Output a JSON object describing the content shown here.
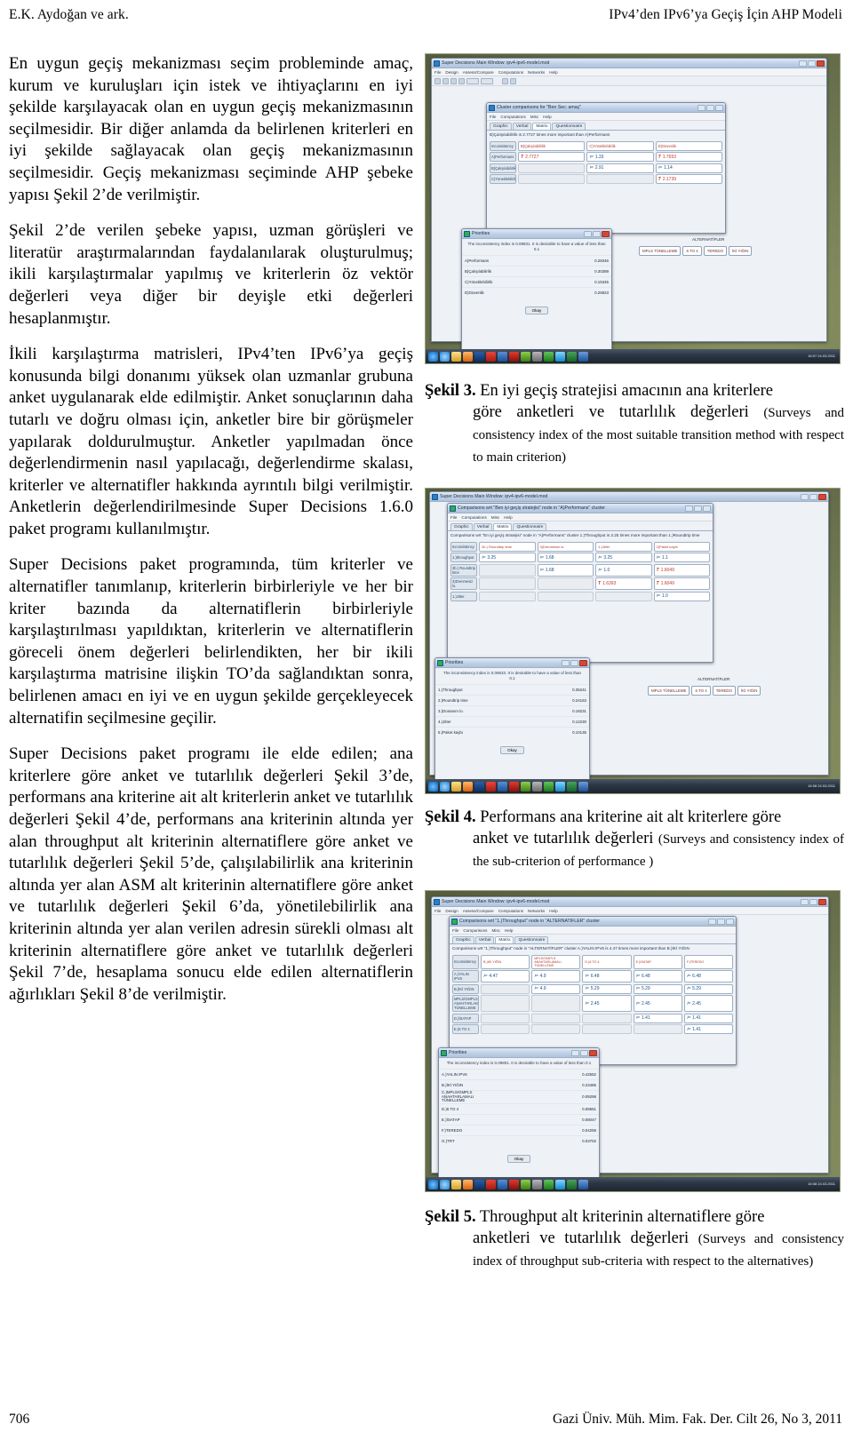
{
  "running_head": {
    "left": "E.K. Aydoğan ve ark.",
    "right": "IPv4’den IPv6’ya Geçiş İçin AHP Modeli"
  },
  "footer": {
    "page_number": "706",
    "journal": "Gazi Üniv. Müh. Mim. Fak. Der. Cilt 26, No 3, 2011"
  },
  "left_column": {
    "paragraphs": [
      "En uygun geçiş mekanizması seçim probleminde amaç, kurum ve kuruluşları için istek ve ihtiyaçlarını en iyi şekilde karşılayacak olan en uygun geçiş mekanizmasının seçilmesidir. Bir diğer anlamda da belirlenen kriterleri en iyi şekilde sağlayacak olan geçiş mekanizmasının seçilmesidir. Geçiş mekanizması seçiminde AHP şebeke yapısı Şekil 2’de verilmiştir.",
      "Şekil 2’de verilen şebeke yapısı,  uzman görüşleri ve literatür araştırmalarından faydalanılarak oluşturulmuş; ikili karşılaştırmalar yapılmış ve kriterlerin öz vektör değerleri veya diğer bir deyişle etki değerleri hesaplanmıştır.",
      "İkili karşılaştırma matrisleri, IPv4’ten IPv6’ya geçiş konusunda bilgi donanımı yüksek olan uzmanlar grubuna anket uygulanarak elde edilmiştir. Anket sonuçlarının daha tutarlı ve doğru olması için, anketler bire bir görüşmeler yapılarak doldurulmuştur. Anketler yapılmadan önce değerlendirmenin nasıl yapılacağı, değerlendirme skalası, kriterler ve alternatifler hakkında ayrıntılı bilgi verilmiştir. Anketlerin değerlendirilmesinde Super Decisions 1.6.0 paket programı kullanılmıştır.",
      "Super Decisions paket programında, tüm kriterler ve alternatifler tanımlanıp, kriterlerin birbirleriyle ve her bir kriter bazında da alternatiflerin birbirleriyle karşılaştırılması yapıldıktan, kriterlerin ve alternatiflerin göreceli önem değerleri belirlendikten, her bir ikili karşılaştırma matrisine ilişkin TO’da sağlandıktan sonra, belirlenen amacı en iyi ve en uygun şekilde gerçekleyecek alternatifin seçilmesine geçilir.",
      "Super Decisions paket programı ile elde edilen; ana kriterlere göre anket ve tutarlılık değerleri Şekil 3’de, performans ana kriterine ait alt kriterlerin anket ve tutarlılık değerleri Şekil 4’de, performans ana kriterinin altında yer alan throughput alt kriterinin alternatiflere göre anket ve tutarlılık değerleri Şekil 5’de, çalışılabilirlik ana kriterinin altında yer alan ASM alt kriterinin alternatiflere göre anket ve tutarlılık değerleri Şekil 6’da, yönetilebilirlik ana kriterinin altında yer alan verilen adresin sürekli olması alt kriterinin alternatiflere göre anket ve tutarlılık değerleri Şekil 7’de, hesaplama sonucu elde edilen alternatiflerin ağırlıkları Şekil 8’de verilmiştir."
    ]
  },
  "figures": [
    {
      "id": "fig3",
      "label": "Şekil 3.",
      "caption_tr_line1": "En iyi geçiş stratejisi amacının ana kriterlere",
      "caption_tr_line2": "göre anketleri ve tutarlılık değerleri",
      "caption_en": "(Surveys and consistency index of the most suitable transition method with respect to main criterion)",
      "screenshot": {
        "main_window_title": "Super Decisions Main Window: ipv4-ipv6-model.mod",
        "main_menu": [
          "File",
          "Design",
          "Assess/Compare",
          "Computations",
          "Networks",
          "Help"
        ],
        "dialog_title": "Cluster comparisons for \"Ben Sec: amaç\"",
        "dialog_menu": [
          "File",
          "Computations",
          "Misc",
          "Help"
        ],
        "tabs": [
          "Graphic",
          "Verbal",
          "Matrix",
          "Questionnaire"
        ],
        "tabs_active": "Matrix",
        "note": "B)Çalışılabilirlik is 2.7727 times more important than A)Performans",
        "matrix": {
          "corner_label": "Inconsistency",
          "col_headers": [
            "B)Çalışılabilirlik",
            "C)Yönetilebilirlik",
            "D)Güvenlik"
          ],
          "row_headers": [
            "A)Performans",
            "B)Çalışılabilirlik",
            "C)Yönetilebilirlik"
          ],
          "cells": [
            [
              "2.7727",
              "1.33",
              "1.7653"
            ],
            [
              "",
              "2.91",
              "1.14"
            ],
            [
              "",
              "",
              "2.1739"
            ]
          ],
          "red_flags": [
            [
              true,
              false,
              true
            ],
            [
              false,
              false,
              false
            ],
            [
              false,
              false,
              true
            ]
          ]
        },
        "priorities": {
          "title": "Priorities",
          "note": "The inconsistency index is 0.08831. It is desirable to have a value of less than 0.1",
          "rows": [
            {
              "name": "A)Performans",
              "value": "0.28346"
            },
            {
              "name": "B)Çalışılabilirlik",
              "value": "0.30389"
            },
            {
              "name": "C)Yönetilebilirlik",
              "value": "0.15345"
            },
            {
              "name": "D)Güvenlik",
              "value": "0.25823"
            }
          ],
          "ok_button": "Okay"
        },
        "alternatives_label": "ALTERNATİFLER",
        "alternative_buttons": [
          "MPLS TÜNELLEME",
          "6 TO 4",
          "TEREDO",
          "İKİ YIĞIN"
        ],
        "taskbar_clock": "16:07 24.03.2011"
      }
    },
    {
      "id": "fig4",
      "label": "Şekil 4.",
      "caption_tr_line1": "Performans ana kriterine ait alt kriterlere göre",
      "caption_tr_line2": "anket ve tutarlılık değerleri",
      "caption_en": "(Surveys and consistency index of the sub-criterion of performance )",
      "screenshot": {
        "main_window_title": "Super Decisions Main Window: ipv4-ipv6-model.mod",
        "dialog_title": "Comparisons wrt \"Ben iyi geçiş stratejisi\" node in \"A)Performans\" cluster",
        "dialog_menu": [
          "File",
          "Computations",
          "Misc",
          "Help"
        ],
        "tabs": [
          "Graphic",
          "Verbal",
          "Matrix",
          "Questionnaire"
        ],
        "tabs_active": "Matrix",
        "note": "Comparisons wrt \"En iyi geçiş stratejisi\" node in \"A)Performans\" cluster 1.)Throughput is 3.25 times more important than 1.)Roundtrip time",
        "matrix": {
          "corner_label": "Inconsistency",
          "col_headers": [
            "2b.) Roundtrip time",
            "3)Drenmesiz lo.",
            "1.)Jitter",
            "2)Paket kaybı"
          ],
          "row_headers": [
            "1.)throughput",
            "2b.) Roundtrip time",
            "3)Drenmesiz lo.",
            "1.)Jitter"
          ],
          "cells": [
            [
              "3.25",
              "1.68",
              "3.25",
              "1.1"
            ],
            [
              "",
              "1.68",
              "1.0",
              "1.6049"
            ],
            [
              "",
              "",
              "1.6393",
              "1.6049"
            ],
            [
              "",
              "",
              "",
              "1.0"
            ]
          ]
        },
        "priorities": {
          "title": "Priorities",
          "note": "The inconsistency index is 0.09633. It is desirable to have a value of less than 0.1",
          "rows": [
            {
              "name": "1.)Throughput",
              "value": "0.35241"
            },
            {
              "name": "2.)Roundtrip time",
              "value": "0.24163"
            },
            {
              "name": "3.)Donanım lo.",
              "value": "0.18231"
            },
            {
              "name": "4.)Jitter",
              "value": "0.12230"
            },
            {
              "name": "5.)Paket kaybı",
              "value": "0.10135"
            }
          ],
          "ok_button": "Okay"
        },
        "alternatives_label": "ALTERNATİFLER",
        "alternative_buttons": [
          "MPLS TÜNELLEME",
          "6 TO 4",
          "TEREDO",
          "İKİ YIĞIN"
        ],
        "taskbar_clock": "16:08 24.03.2011"
      }
    },
    {
      "id": "fig5",
      "label": "Şekil 5.",
      "caption_tr_line1": "Throughput alt kriterinin alternatiflere göre",
      "caption_tr_line2": "anketleri ve tutarlılık değerleri",
      "caption_en": "(Surveys and consistency index of throughput sub-criteria with respect to the alternatives)",
      "screenshot": {
        "main_window_title": "Super Decisions Main Window: ipv4-ipv6-model.mod",
        "dialog_title": "Comparisons wrt \"1.)Throughput\" node in \"ALTERNATİFLER\" cluster",
        "dialog_menu": [
          "File",
          "Comparisons",
          "Misc",
          "Help"
        ],
        "tabs": [
          "Graphic",
          "Verbal",
          "Matrix",
          "Questionnaire"
        ],
        "tabs_active": "Matrix",
        "note": "Comparisons wrt \"1.)Throughput\" node in \"ALTERNATİFLER\" cluster A.)YALIN IPV6 is 4.47 times more important than B.)İKİ YIĞIN",
        "matrix": {
          "corner_label": "Inconsistency",
          "col_headers": [
            "B.)İKİ YIĞIN",
            "MPLS/GMPLS ANAHTARLAMALI TÜNELLEME",
            "D.)6 TO 4",
            "E.)İSATAP",
            "F.)TEREDO"
          ],
          "row_headers": [
            "A.)YALIN IPV6",
            "B.)İKİ YIĞIN",
            "MPLS/GMPLS ANAHTARLAMALI TÜNELLEME",
            "D.)İSATAP",
            "E.)6 TO 4"
          ],
          "cells": [
            [
              "4.47",
              "4.9",
              "6.48",
              "6.48",
              "6.48"
            ],
            [
              "",
              "4.9",
              "5.29",
              "5.29",
              "5.29"
            ],
            [
              "",
              "",
              "2.45",
              "2.45",
              "2.45"
            ],
            [
              "",
              "",
              "",
              "1.41",
              "1.41"
            ],
            [
              "",
              "",
              "",
              "",
              "1.41"
            ]
          ]
        },
        "priorities": {
          "title": "Priorities",
          "note": "The inconsistency index is 0.09801. It is desirable to have a value of less than 0.1",
          "rows": [
            {
              "name": "A.)YALIN IPV6",
              "value": "0.42552"
            },
            {
              "name": "B.)İKİ YIĞIN",
              "value": "0.23485"
            },
            {
              "name": "C.)MPLS/GMPLS ANAHTARLAMALI TÜNELLEME",
              "value": "0.09298"
            },
            {
              "name": "D.)6 TO 4",
              "value": "0.08651"
            },
            {
              "name": "E.)İSATAP",
              "value": "0.08047"
            },
            {
              "name": "F.)TEREDO",
              "value": "0.04259"
            },
            {
              "name": "G.)TRT",
              "value": "0.03702"
            }
          ],
          "ok_button": "Okay"
        },
        "taskbar_clock": "16:08 24.03.2011"
      }
    }
  ]
}
